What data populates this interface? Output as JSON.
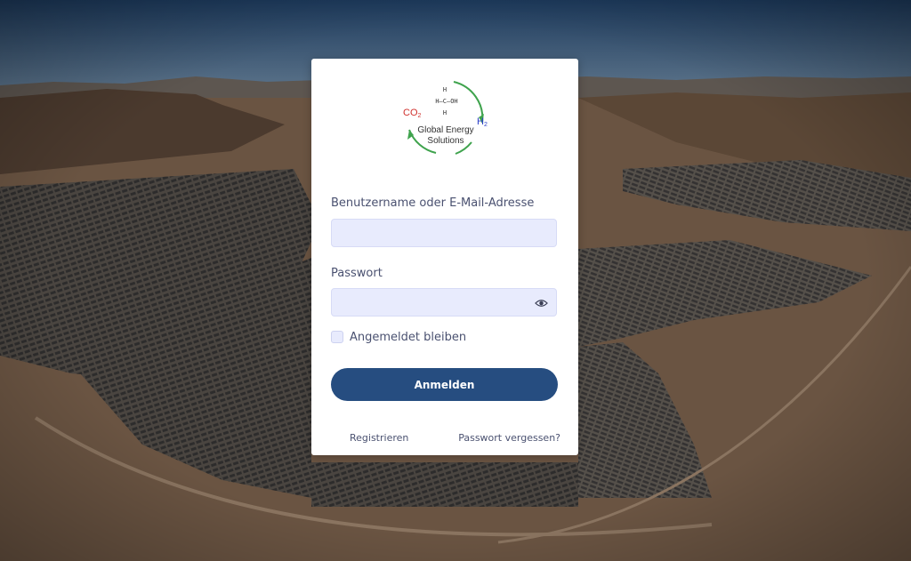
{
  "logo": {
    "formula_h_top": "H",
    "formula_main": "H–C–OH",
    "formula_h_bottom": "H",
    "co2": "CO",
    "co2_sub": "2",
    "h2": "H",
    "h2_sub": "2",
    "line1": "Global Energy",
    "line2": "Solutions",
    "colors": {
      "co2": "#d0312d",
      "h2": "#2b3fc7",
      "arrow": "#3fa34d"
    }
  },
  "form": {
    "username_label": "Benutzername oder E-Mail-Adresse",
    "username_value": "",
    "password_label": "Passwort",
    "password_value": "",
    "remember_label": "Angemeldet bleiben",
    "submit_label": "Anmelden",
    "register_link": "Registrieren",
    "forgot_link": "Passwort vergessen?"
  },
  "icons": {
    "password_toggle": "eye-icon"
  },
  "colors": {
    "button": "#264d80",
    "input_bg": "#e8ebfd",
    "label": "#4a5170"
  }
}
